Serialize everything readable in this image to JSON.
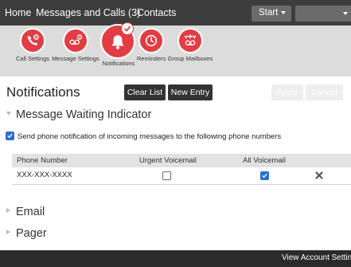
{
  "topnav": {
    "home": "Home",
    "messages": "Messages and Calls (3)",
    "contacts": "Contacts",
    "start": "Start"
  },
  "iconbar": {
    "items": [
      {
        "label": "Call Settings",
        "icon": "phone-gear-icon"
      },
      {
        "label": "Message Settings",
        "icon": "voicemail-gear-icon"
      },
      {
        "label": "Notifications",
        "icon": "bell-icon"
      },
      {
        "label": "Reminders",
        "icon": "clock-icon"
      },
      {
        "label": "Group Mailboxes",
        "icon": "group-voicemail-icon"
      }
    ],
    "active": "Notifications"
  },
  "page": {
    "title": "Notifications",
    "clear_list": "Clear List",
    "new_entry": "New Entry",
    "apply": "Apply",
    "cancel": "Cancel"
  },
  "mwi": {
    "header": "Message Waiting Indicator",
    "send_label": "Send phone notification of incoming messages to the following phone numbers",
    "send_checked": true,
    "columns": [
      "Phone Number",
      "Urgent Voicemail",
      "All Voicemail"
    ],
    "rows": [
      {
        "phone": "XXX-XXX-XXXX",
        "urgent": false,
        "all": true
      }
    ]
  },
  "sections": {
    "email": "Email",
    "pager": "Pager"
  },
  "footer": {
    "link": "View Account Settings"
  },
  "colors": {
    "accent_red": "#e23c44",
    "nav_bg": "#3d3d3d",
    "checkbox_blue": "#2b6fd1"
  }
}
